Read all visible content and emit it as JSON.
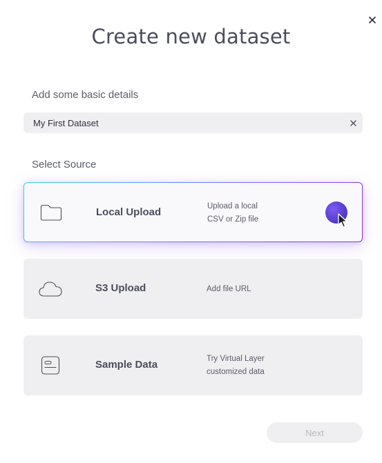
{
  "dialog": {
    "title": "Create new dataset",
    "close_icon": "close-icon"
  },
  "details": {
    "label": "Add some basic details",
    "name_value": "My First Dataset",
    "clear_icon": "clear-icon"
  },
  "source": {
    "label": "Select Source",
    "options": [
      {
        "title": "Local Upload",
        "desc_line1": "Upload a local",
        "desc_line2": "CSV or Zip file",
        "icon": "folder-icon",
        "selected": true
      },
      {
        "title": "S3 Upload",
        "desc_line1": "Add file URL",
        "desc_line2": "",
        "icon": "cloud-icon",
        "selected": false
      },
      {
        "title": "Sample Data",
        "desc_line1": "Try Virtual Layer",
        "desc_line2": "customized data",
        "icon": "document-icon",
        "selected": false
      }
    ]
  },
  "footer": {
    "next_label": "Next",
    "next_enabled": false
  },
  "colors": {
    "accent_gradient_start": "#39d4f0",
    "accent_gradient_end": "#8a2be2",
    "indicator": "#5b3fd6",
    "card_bg": "#efeff1"
  }
}
